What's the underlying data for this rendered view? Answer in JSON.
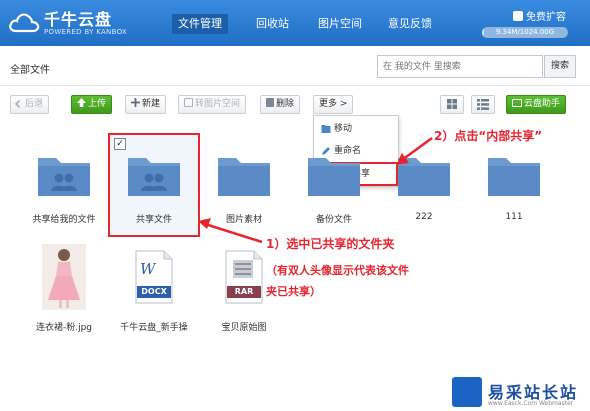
{
  "header": {
    "logo_title": "千牛云盘",
    "logo_sub": "POWERED BY KANBOX",
    "nav": [
      "文件管理",
      "回收站",
      "图片空间",
      "意见反馈"
    ],
    "active_nav": "文件管理",
    "upgrade_label": "免费扩容",
    "quota_text": "9.34M/1024.00G",
    "quota_fraction": 0.01,
    "brand_color": "#2d7fd2"
  },
  "breadcrumb": "全部文件",
  "search": {
    "placeholder": "在 我的文件 里搜索",
    "button": "搜索"
  },
  "toolbar": {
    "back": "后退",
    "upload": "上传",
    "new": "新建",
    "to_image": "转图片空间",
    "delete": "删除",
    "more": "更多 >",
    "helper": "云盘助手"
  },
  "more_menu": [
    "移动",
    "重命名",
    "内部共享"
  ],
  "files": [
    {
      "name": "共享给我的文件",
      "type": "shared-folder"
    },
    {
      "name": "共享文件",
      "type": "shared-folder",
      "selected": true
    },
    {
      "name": "图片素材",
      "type": "folder"
    },
    {
      "name": "备份文件",
      "type": "folder"
    },
    {
      "name": "222",
      "type": "folder"
    },
    {
      "name": "111",
      "type": "folder"
    },
    {
      "name": "连衣裙-粉.jpg",
      "type": "image"
    },
    {
      "name": "千牛云盘_新手操",
      "type": "docx",
      "badge": "DOCX"
    },
    {
      "name": "宝贝原始图",
      "type": "rar",
      "badge": "RAR"
    }
  ],
  "annotations": {
    "step1": "1）选中已共享的文件夹",
    "step1_note_line1": "（有双人头像显示代表该文件",
    "step1_note_line2": "夹已共享）",
    "step2": "2）点击“内部共享”"
  },
  "watermark": {
    "title": "易采站长站",
    "url": "www.Easck.Com Webmaster"
  }
}
